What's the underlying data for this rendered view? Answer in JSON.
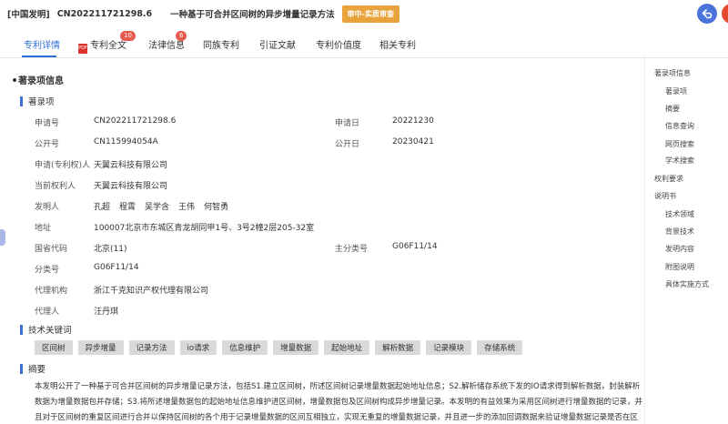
{
  "header": {
    "tag": "[中国发明]",
    "patent_no": "CN202211721298.6",
    "title": "一种基于可合并区间树的异步增量记录方法",
    "status": "审中-实质审查",
    "colors": {
      "status_bg": "#e8a33c",
      "back_btn": "#4a74d9",
      "more_btn": "#e34a2f"
    }
  },
  "tabs": [
    {
      "label": "专利详情",
      "active": true
    },
    {
      "label": "专利全文",
      "badge": "10",
      "icon": "pdf-icon"
    },
    {
      "label": "法律信息",
      "badge": "6"
    },
    {
      "label": "同族专利"
    },
    {
      "label": "引证文献"
    },
    {
      "label": "专利价值度"
    },
    {
      "label": "相关专利"
    }
  ],
  "section_title": "著录项信息",
  "biblio": {
    "heading": "著录项",
    "app_no_label": "申请号",
    "app_no": "CN202211721298.6",
    "app_date_label": "申请日",
    "app_date": "20221230",
    "pub_no_label": "公开号",
    "pub_no": "CN115994054A",
    "pub_date_label": "公开日",
    "pub_date": "20230421",
    "applicant_label": "申请(专利权)人",
    "applicant": "天翼云科技有限公司",
    "owner_label": "当前权利人",
    "owner": "天翼云科技有限公司",
    "inventor_label": "发明人",
    "inventors": [
      "孔超",
      "程霄",
      "吴学含",
      "王伟",
      "何智勇"
    ],
    "address_label": "地址",
    "address": "100007北京市东城区青龙胡同甲1号、3号2幢2层205-32室",
    "province_label": "国省代码",
    "province": "北京(11)",
    "main_class_label": "主分类号",
    "main_class": "G06F11/14",
    "class_label": "分类号",
    "class": "G06F11/14",
    "agency_label": "代理机构",
    "agency": "浙江千克知识产权代理有限公司",
    "agent_label": "代理人",
    "agent": "汪丹琪"
  },
  "keywords": {
    "heading": "技术关键词",
    "items": [
      "区间树",
      "异步增量",
      "记录方法",
      "io请求",
      "信息维护",
      "增量数据",
      "起始地址",
      "解析数据",
      "记录模块",
      "存储系统"
    ]
  },
  "abstract": {
    "heading": "摘要",
    "line1": "本发明公开了一种基于可合并区间树的异步增量记录方法，包括S1.建立区间树，所述区间树记录增量数据起始地址信息；S2.解析储存系统下发的IO请求得到解析数据，封装解析",
    "line2": "数据为增量数据包并存储；S3.将所述增量数据包的起始地址信息维护进区间树，增量数据包及区间树构成异步增量记录。本发明的有益效果为采用区间树进行增量数据的记录，并",
    "line3": "且对于区间树的重复区间进行合并以保持区间树的各个用于记录增量数据的区间互相独立，实现无重复的增量数据记录，并且进一步的添加回调数据来验证增量数据记录是否在区"
  },
  "right_nav": {
    "items": [
      "著录项信息",
      "著录项",
      "摘要",
      "信息查询",
      "网页搜索",
      "学术搜索",
      "权利要求",
      "说明书",
      "技术领域",
      "背景技术",
      "发明内容",
      "附图说明",
      "具体实施方式"
    ]
  }
}
